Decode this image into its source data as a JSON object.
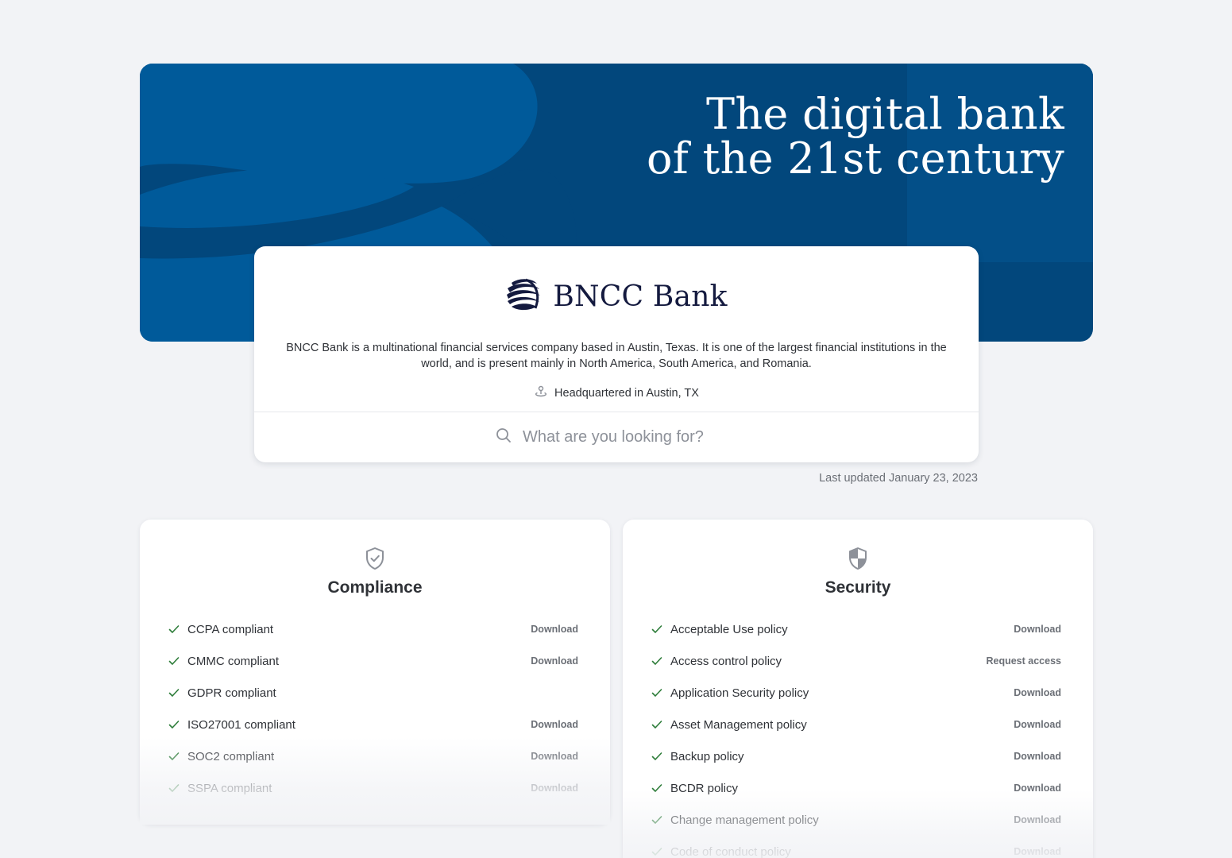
{
  "hero": {
    "title_line1": "The digital bank",
    "title_line2": "of the 21st century",
    "colors": {
      "background": "#02477c",
      "swoosh": "#005a9a"
    }
  },
  "company": {
    "logo_icon": "bncc-swirl-logo-icon",
    "name": "BNCC Bank",
    "description": "BNCC Bank is a multinational financial services company based in Austin, Texas. It is one of the largest financial institutions in the world, and is present mainly in North America, South America, and Romania.",
    "headquarters": "Headquartered in Austin, TX",
    "headquarters_icon": "location-pin-icon"
  },
  "search": {
    "icon": "search-icon",
    "placeholder": "What are you looking for?",
    "value": ""
  },
  "last_updated": "Last updated January 23, 2023",
  "compliance": {
    "icon": "shield-check-icon",
    "title": "Compliance",
    "items": [
      {
        "label": "CCPA compliant",
        "action": "Download"
      },
      {
        "label": "CMMC compliant",
        "action": "Download"
      },
      {
        "label": "GDPR compliant",
        "action": ""
      },
      {
        "label": "ISO27001 compliant",
        "action": "Download"
      },
      {
        "label": "SOC2 compliant",
        "action": "Download"
      },
      {
        "label": "SSPA compliant",
        "action": "Download"
      }
    ]
  },
  "security": {
    "icon": "shield-half-icon",
    "title": "Security",
    "items": [
      {
        "label": "Acceptable Use policy",
        "action": "Download"
      },
      {
        "label": "Access control policy",
        "action": "Request access"
      },
      {
        "label": "Application Security policy",
        "action": "Download"
      },
      {
        "label": "Asset Management policy",
        "action": "Download"
      },
      {
        "label": "Backup policy",
        "action": "Download"
      },
      {
        "label": "BCDR policy",
        "action": "Download"
      },
      {
        "label": "Change management policy",
        "action": "Download"
      },
      {
        "label": "Code of conduct policy",
        "action": "Download"
      }
    ]
  },
  "colors": {
    "check": "#2e7d3a",
    "page_background": "#f2f3f6"
  }
}
